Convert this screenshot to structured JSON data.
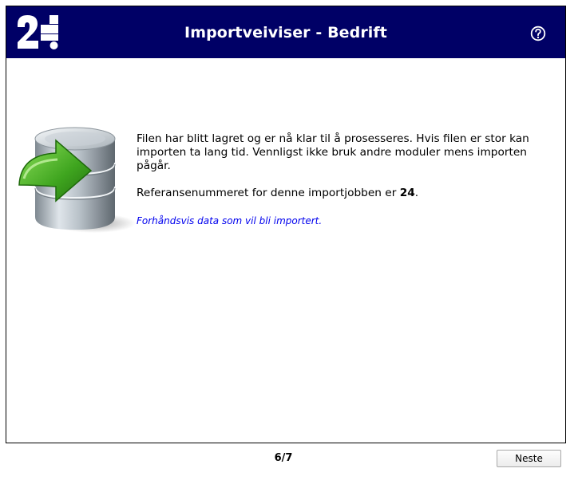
{
  "header": {
    "logo_name": "24SevenOffice logo",
    "title": "Importveiviser - Bedrift",
    "help_icon": "question-circle-icon"
  },
  "main": {
    "illustration_icon": "database-import-icon",
    "status_text": "Filen har blitt lagret og er nå klar til å prosesseres. Hvis filen er stor kan importen ta lang tid. Vennligst ikke bruk andre moduler mens importen pågår.",
    "reference_prefix": "Referansenummeret for denne importjobben er ",
    "reference_number": "24",
    "reference_suffix": ".",
    "preview_link": "Forhåndsvis data som vil bli importert."
  },
  "footer": {
    "step": "6/7",
    "next_label": "Neste"
  },
  "colors": {
    "header_bg": "#000066",
    "link": "#0000ee",
    "arrow_green": "#3a9a1e"
  }
}
